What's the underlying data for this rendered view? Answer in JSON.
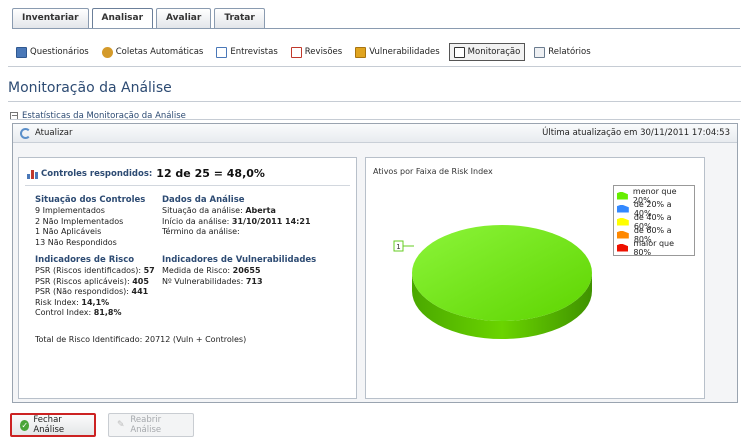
{
  "main_tabs": [
    {
      "label": "Inventariar"
    },
    {
      "label": "Analisar"
    },
    {
      "label": "Avaliar"
    },
    {
      "label": "Tratar"
    }
  ],
  "subnav": [
    {
      "label": "Questionários",
      "icon": "questionnaire-icon",
      "color": "#4a78b8"
    },
    {
      "label": "Coletas Automáticas",
      "icon": "automatic-collection-icon",
      "color": "#d49a2a"
    },
    {
      "label": "Entrevistas",
      "icon": "interview-icon",
      "color": "#4a78b8"
    },
    {
      "label": "Revisões",
      "icon": "review-icon",
      "color": "#c0392b"
    },
    {
      "label": "Vulnerabilidades",
      "icon": "vulnerability-icon",
      "color": "#e0a41f"
    },
    {
      "label": "Monitoração",
      "icon": "monitoring-icon",
      "color": "#333333"
    },
    {
      "label": "Relatórios",
      "icon": "report-icon",
      "color": "#6b7c8f"
    }
  ],
  "page": {
    "title": "Monitoração da Análise",
    "section_title": "Estatísticas da Monitoração da Análise",
    "refresh_label": "Atualizar",
    "last_update": "Última atualização em 30/11/2011 17:04:53"
  },
  "controls": {
    "label": "Controles respondidos:",
    "value": "12 de 25 = 48,0%"
  },
  "situacao": {
    "title": "Situação dos Controles",
    "lines": [
      {
        "num": "9",
        "text": " Implementados"
      },
      {
        "num": "2",
        "text": " Não Implementados"
      },
      {
        "num": "1",
        "text": " Não Aplicáveis"
      },
      {
        "num": "13",
        "text": " Não Respondidos"
      }
    ]
  },
  "dados": {
    "title": "Dados da Análise",
    "lines": [
      {
        "label": "Situação da análise: ",
        "value": "Aberta"
      },
      {
        "label": "Início da análise: ",
        "value": "31/10/2011 14:21"
      },
      {
        "label": "Término da análise:",
        "value": ""
      }
    ]
  },
  "risco": {
    "title": "Indicadores de Risco",
    "lines": [
      {
        "label": "PSR (Riscos identificados): ",
        "value": "57"
      },
      {
        "label": "PSR (Riscos aplicáveis): ",
        "value": "405"
      },
      {
        "label": "PSR (Não respondidos): ",
        "value": "441"
      },
      {
        "label": "Risk Index: ",
        "value": "14,1%"
      },
      {
        "label": "Control Index: ",
        "value": "81,8%"
      }
    ]
  },
  "vuln": {
    "title": "Indicadores de Vulnerabilidades",
    "lines": [
      {
        "label": "Medida de Risco: ",
        "value": "20655"
      },
      {
        "label": "Nº Vulnerabilidades: ",
        "value": "713"
      }
    ]
  },
  "total_risk": "Total de Risco Identificado: 20712 (Vuln + Controles)",
  "chart_data": {
    "type": "pie",
    "title": "Ativos por Faixa de Risk Index",
    "categories": [
      "menor que 20%",
      "de 20% a 40%",
      "de 40% a 60%",
      "de 60% a 80%",
      "maior que 80%"
    ],
    "colors": [
      "#66ee00",
      "#3388ff",
      "#ffff00",
      "#ff8800",
      "#ee1100"
    ],
    "values": [
      100,
      0,
      0,
      0,
      0
    ],
    "slice_labels": [
      "1"
    ],
    "legend_position": "top-right"
  },
  "buttons": {
    "close_label": "Fechar Análise",
    "reopen_label": "Reabrir Análise"
  }
}
